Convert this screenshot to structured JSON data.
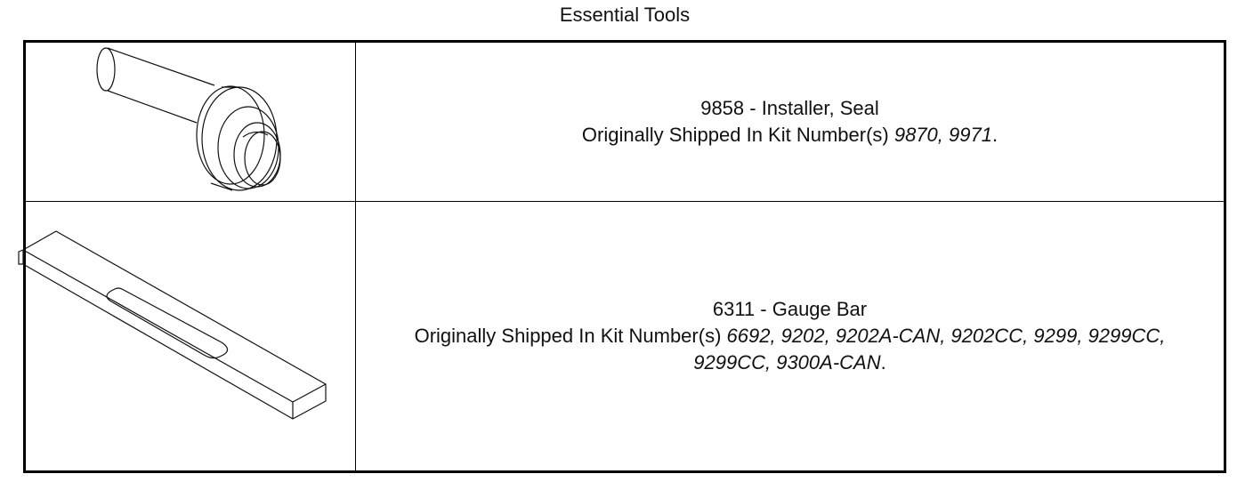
{
  "page": {
    "title": "Essential Tools"
  },
  "tools": [
    {
      "id_name": "9858 - Installer, Seal",
      "kits_prefix": "Originally Shipped In Kit Number(s) ",
      "kits_line1": "9870, 9971",
      "kits_line2": "",
      "kits_suffix": ".",
      "icon": "seal-installer-icon"
    },
    {
      "id_name": "6311 - Gauge Bar",
      "kits_prefix": "Originally Shipped In Kit Number(s) ",
      "kits_line1": "6692, 9202, 9202A-CAN, 9202CC, 9299, 9299CC,",
      "kits_line2": "9299CC, 9300A-CAN",
      "kits_suffix": ".",
      "icon": "gauge-bar-icon"
    }
  ]
}
